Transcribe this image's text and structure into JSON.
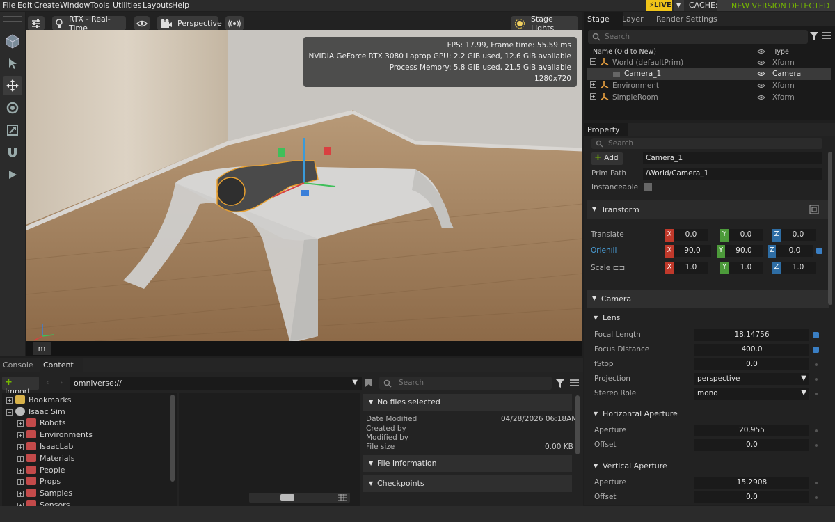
{
  "menu": [
    "File",
    "Edit",
    "Create",
    "Window",
    "Tools",
    "Utilities",
    "Layouts",
    "Help"
  ],
  "topright": {
    "live": "LIVE",
    "cache": "CACHE:",
    "new_version": "NEW VERSION DETECTED"
  },
  "viewport": {
    "renderer": "RTX - Real-Time",
    "camera": "Perspective",
    "lights": "Stage Lights",
    "stats": [
      "FPS: 17.99, Frame time: 55.59 ms",
      "NVIDIA GeForce RTX 3080 Laptop GPU: 2.2 GiB used, 12.6 GiB available",
      "Process Memory: 5.8 GiB used, 21.5 GiB available",
      "1280x720"
    ],
    "footer_label": "m"
  },
  "stage": {
    "tabs": [
      "Stage",
      "Layer",
      "Render Settings"
    ],
    "search_placeholder": "Search",
    "col_name": "Name (Old to New)",
    "col_type": "Type",
    "rows": [
      {
        "name": "World (defaultPrim)",
        "type": "Xform"
      },
      {
        "name": "Camera_1",
        "type": "Camera"
      },
      {
        "name": "Environment",
        "type": "Xform"
      },
      {
        "name": "SimpleRoom",
        "type": "Xform"
      }
    ]
  },
  "property": {
    "tab": "Property",
    "search_placeholder": "Search",
    "add_label": "Add",
    "prim_name": "Camera_1",
    "prim_path_label": "Prim Path",
    "prim_path": "/World/Camera_1",
    "instanceable_label": "Instanceable",
    "transform": {
      "title": "Transform",
      "translate_label": "Translate",
      "orient_label": "Orien",
      "scale_label": "Scale",
      "translate": [
        "0.0",
        "0.0",
        "0.0"
      ],
      "orient": [
        "90.0",
        "90.0",
        "0.0"
      ],
      "scale": [
        "1.0",
        "1.0",
        "1.0"
      ],
      "axes": [
        "X",
        "Y",
        "Z"
      ]
    },
    "camera": {
      "title": "Camera",
      "lens_title": "Lens",
      "focal_length_label": "Focal Length",
      "focal_length": "18.14756",
      "focus_distance_label": "Focus Distance",
      "focus_distance": "400.0",
      "fstop_label": "fStop",
      "fstop": "0.0",
      "projection_label": "Projection",
      "projection": "perspective",
      "stereo_label": "Stereo Role",
      "stereo": "mono",
      "haperture_title": "Horizontal Aperture",
      "h_aperture_label": "Aperture",
      "h_aperture": "20.955",
      "h_offset_label": "Offset",
      "h_offset": "0.0",
      "vaperture_title": "Vertical Aperture",
      "v_aperture_label": "Aperture",
      "v_aperture": "15.2908",
      "v_offset_label": "Offset",
      "v_offset": "0.0"
    }
  },
  "bottom": {
    "tabs": [
      "Console",
      "Content"
    ],
    "import_label": "Import",
    "path": "omniverse://",
    "search_placeholder": "Search",
    "tree": {
      "bookmarks": "Bookmarks",
      "root": "Isaac Sim",
      "children": [
        "Robots",
        "Environments",
        "IsaacLab",
        "Materials",
        "People",
        "Props",
        "Samples",
        "Sensors"
      ]
    },
    "details": {
      "no_files": "No files selected",
      "date_label": "Date Modified",
      "date_value": "04/28/2026 06:18AM",
      "created_label": "Created by",
      "modified_label": "Modified by",
      "size_label": "File size",
      "size_value": "0.00 KB",
      "file_info": "File Information",
      "checkpoints": "Checkpoints"
    }
  },
  "colors": {
    "accent": "#76b900",
    "live": "#f0c419",
    "x_axis": "#c0392b",
    "y_axis": "#4c9a3a",
    "z_axis": "#2e6da4"
  }
}
